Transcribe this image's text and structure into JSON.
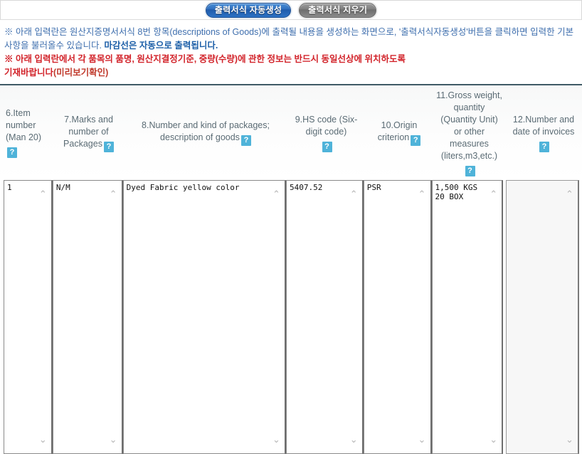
{
  "toolbar": {
    "generate_button": "출력서식 자동생성",
    "clear_button": "출력서식 지우기"
  },
  "notice": {
    "line1_part1": "※ 아래 입력란은 원산지증명서서식 8번 항목(descriptions of Goods)에 출력될 내용을 생성하는 화면으로, '출력서식자동생성'버튼을 클릭하면 입력한 기본사항을 불러올수 있습니다. ",
    "line1_emphasis": "마감선은 자동으로 출력됩니다.",
    "line2": "※ 아래 입력란에서 각 품목의 품명, 원산지결정기준, 중량(수량)에 관한 정보는 반드시 동일선상에 위치하도록",
    "line3_main": "기재바랍니다",
    "line3_sub": "(미리보기확인)"
  },
  "help_badge": "?",
  "arrows": {
    "up": "⌃",
    "down": "⌄"
  },
  "columns": [
    {
      "id": "item-number",
      "header_lines": "6.Item\nnumber\n(Man 20)",
      "has_help": true,
      "value": "1",
      "disabled": false
    },
    {
      "id": "marks-and-number-of-packages",
      "header_lines": "7.Marks and\nnumber of\nPackages",
      "has_help": true,
      "value": "N/M",
      "disabled": false
    },
    {
      "id": "number-kind-description-of-goods",
      "header_lines": "8.Number and kind of packages;\ndescription of goods",
      "has_help": true,
      "value": "Dyed Fabric yellow color",
      "disabled": false
    },
    {
      "id": "hs-code",
      "header_lines": "9.HS code\n(Six-digit code)",
      "has_help": true,
      "value": "5407.52",
      "disabled": false
    },
    {
      "id": "origin-criterion",
      "header_lines": "10.Origin\ncriterion",
      "has_help": true,
      "value": "PSR",
      "disabled": false
    },
    {
      "id": "gross-weight-quantity",
      "header_lines": "11.Gross\nweight, quantity\n(Quantity Unit)\nor other\nmeasures\n(liters,m3,etc.)",
      "has_help": true,
      "value": "1,500 KGS\n20 BOX",
      "disabled": false
    },
    {
      "id": "number-and-date-of-invoices",
      "header_lines": "12.Number and\ndate of invoices",
      "has_help": true,
      "value": "",
      "disabled": true
    }
  ],
  "colors": {
    "accent_blue": "#2f6fbe",
    "help_badge": "#4fb3d9",
    "notice_blue": "#3f6fae",
    "notice_red": "#d2232a",
    "divider": "#3f5a66"
  }
}
